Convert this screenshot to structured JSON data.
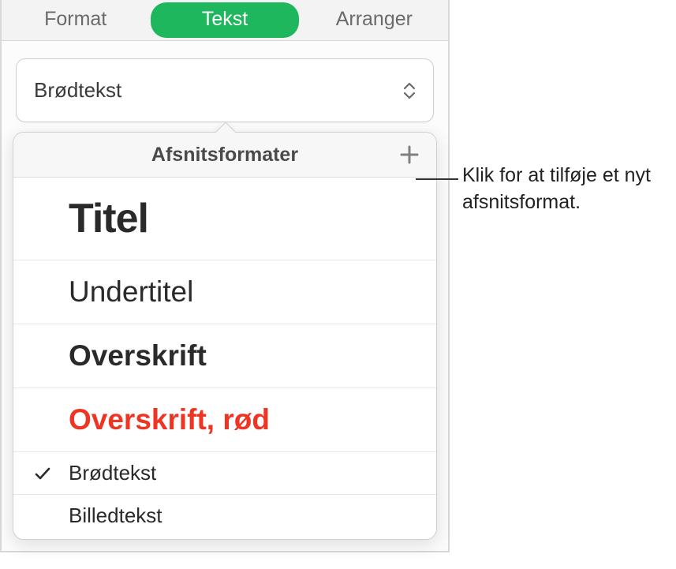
{
  "tabs": {
    "format": "Format",
    "tekst": "Tekst",
    "arranger": "Arranger"
  },
  "style_selector": {
    "current": "Brødtekst"
  },
  "popover": {
    "title": "Afsnitsformater",
    "items": [
      {
        "label": "Titel",
        "class": "titel",
        "selected": false
      },
      {
        "label": "Undertitel",
        "class": "undertitel",
        "selected": false
      },
      {
        "label": "Overskrift",
        "class": "overskrift",
        "selected": false
      },
      {
        "label": "Overskrift, rød",
        "class": "overskrift-rod",
        "selected": false
      },
      {
        "label": "Brødtekst",
        "class": "brodtekst",
        "selected": true
      },
      {
        "label": "Billedtekst",
        "class": "billedtekst",
        "selected": false
      }
    ]
  },
  "callout": {
    "text": "Klik for at tilføje et nyt afsnitsformat."
  }
}
